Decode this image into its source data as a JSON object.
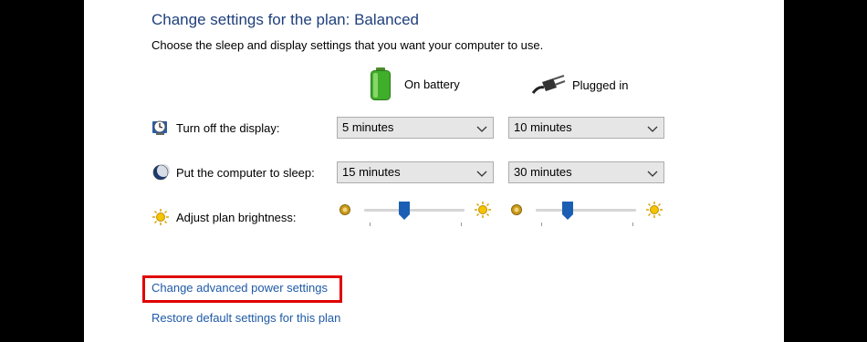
{
  "header": {
    "title": "Change settings for the plan: Balanced",
    "subtitle": "Choose the sleep and display settings that you want your computer to use."
  },
  "columns": {
    "on_battery": {
      "label": "On battery",
      "icon": "battery-icon"
    },
    "plugged_in": {
      "label": "Plugged in",
      "icon": "power-plug-icon"
    }
  },
  "settings": {
    "display": {
      "label": "Turn off the display:",
      "icon": "display-clock-icon",
      "on_battery": "5 minutes",
      "plugged_in": "10 minutes"
    },
    "sleep": {
      "label": "Put the computer to sleep:",
      "icon": "moon-icon",
      "on_battery": "15 minutes",
      "plugged_in": "30 minutes"
    },
    "brightness": {
      "label": "Adjust plan brightness:",
      "icon": "sun-icon",
      "on_battery_level": 0.4,
      "plugged_in_level": 0.32
    }
  },
  "links": {
    "advanced": "Change advanced power settings",
    "restore": "Restore default settings for this plan"
  },
  "colors": {
    "title": "#1e3f7c",
    "link": "#1f5aa6",
    "highlight": "#e00000",
    "slider_thumb": "#1a5fb4"
  }
}
